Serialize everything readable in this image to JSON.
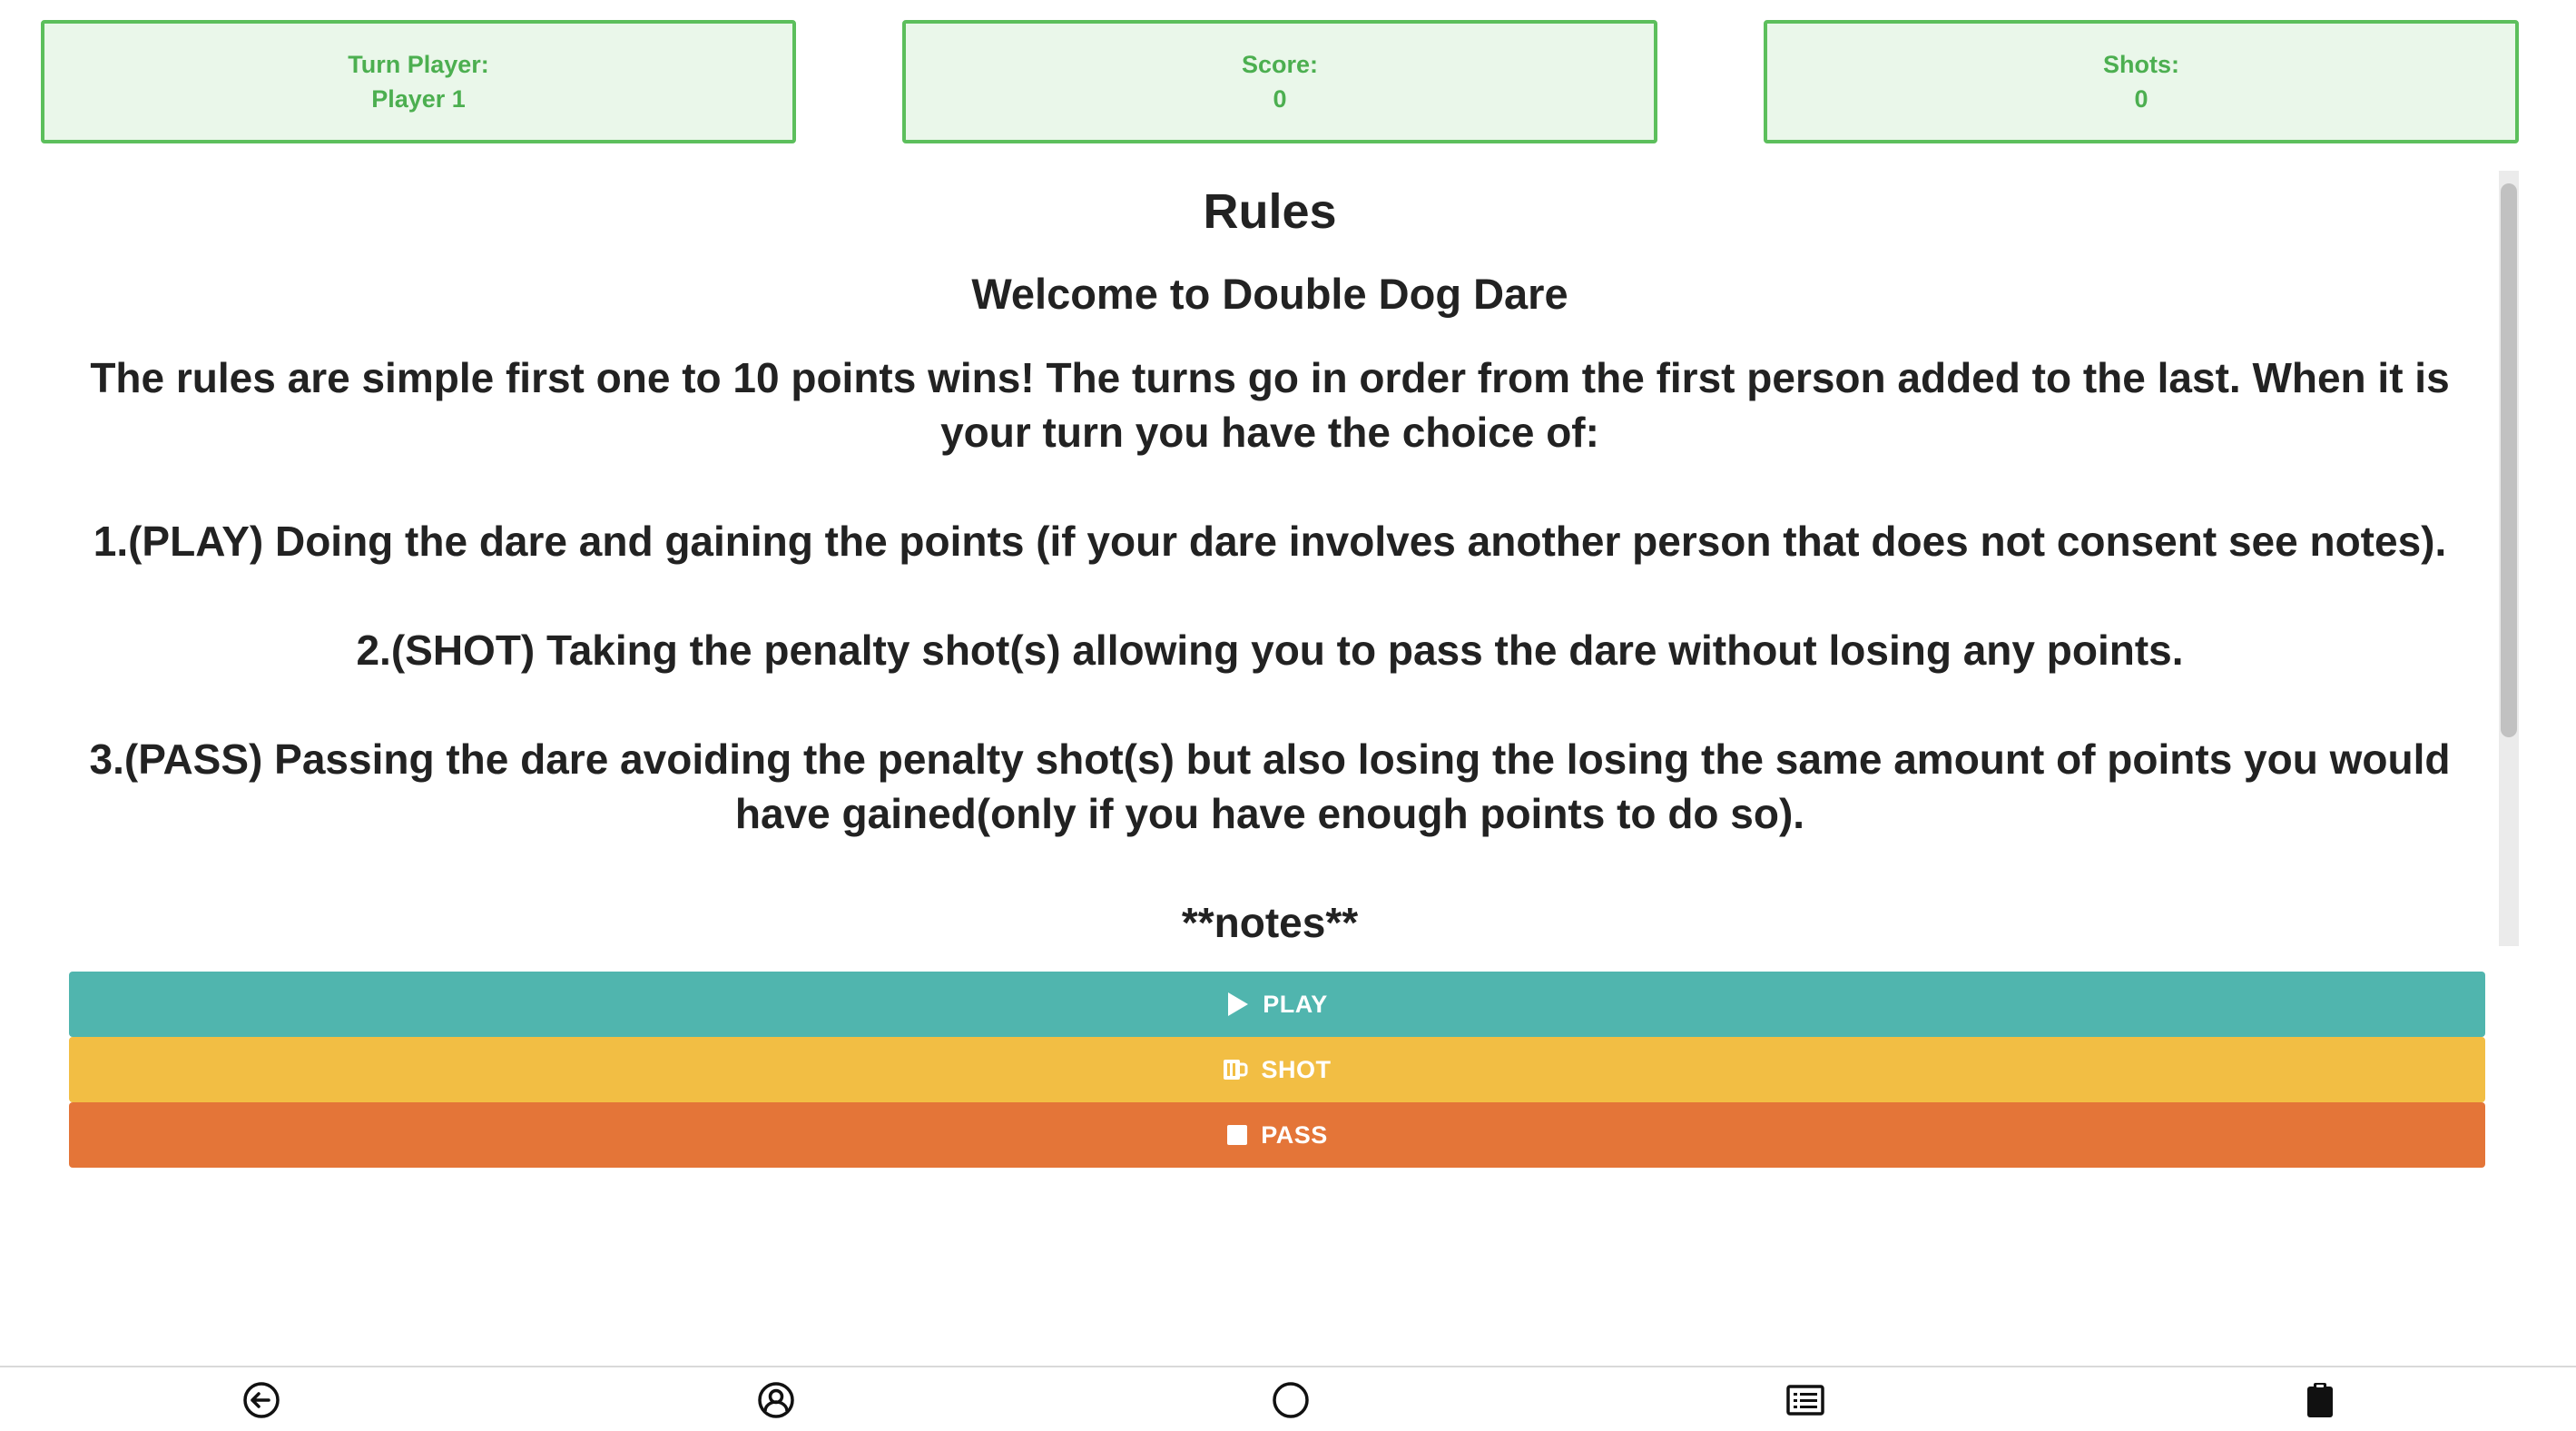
{
  "stats": {
    "turn_player": {
      "label": "Turn Player:",
      "value": "Player 1"
    },
    "score": {
      "label": "Score:",
      "value": "0"
    },
    "shots": {
      "label": "Shots:",
      "value": "0"
    }
  },
  "rules": {
    "title": "Rules",
    "welcome": "Welcome to Double Dog Dare",
    "paragraphs": [
      "The rules are simple first one to 10 points wins! The turns go in order from the first person added to the last. When it is your turn you have the choice of:",
      "1.(PLAY) Doing the dare and gaining the points (if your dare involves another person that does not consent see notes).",
      "2.(SHOT) Taking the penalty shot(s) allowing you to pass the dare without losing any points.",
      "3.(PASS) Passing the dare avoiding the penalty shot(s) but also losing the losing the same amount of points you would have gained(only if you have enough points to do so)."
    ],
    "notes_heading": "**notes**"
  },
  "actions": {
    "play": {
      "label": "PLAY",
      "icon": "play-icon",
      "color": "#50b5ae"
    },
    "shot": {
      "label": "SHOT",
      "icon": "mug-icon",
      "color": "#f2be44"
    },
    "pass": {
      "label": "PASS",
      "icon": "stop-icon",
      "color": "#e47538"
    }
  },
  "bottom_nav": [
    "back-icon",
    "user-circle-icon",
    "circle-icon",
    "list-icon",
    "clipboard-icon"
  ],
  "colors": {
    "stat_border": "#5cbf5c",
    "stat_background": "#eaf7ea",
    "stat_text": "#4caf50"
  }
}
